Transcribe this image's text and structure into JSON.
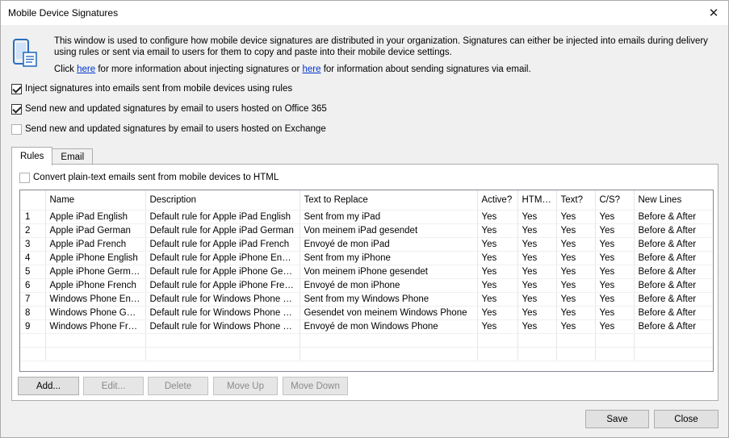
{
  "window": {
    "title": "Mobile Device Signatures"
  },
  "intro": {
    "paragraph": "This window is used to configure how mobile device signatures are distributed in your organization. Signatures can either be injected into emails during delivery using rules or sent via email to users for them to copy and paste into their mobile device settings.",
    "click": "Click ",
    "here1": "here",
    "middle": " for more information about injecting signatures or ",
    "here2": "here",
    "end": " for information about sending signatures via email."
  },
  "options": {
    "inject": {
      "label": "Inject signatures into emails sent from mobile devices using rules",
      "checked": true
    },
    "office365": {
      "label": "Send new and updated signatures by email to users hosted on Office 365",
      "checked": true
    },
    "exchange": {
      "label": "Send new and updated signatures by email to users hosted on Exchange",
      "checked": false
    }
  },
  "tabs": [
    "Rules",
    "Email"
  ],
  "convert": {
    "label": "Convert plain-text emails sent from mobile devices to HTML",
    "checked": false
  },
  "table": {
    "columns": [
      "",
      "Name",
      "Description",
      "Text to Replace",
      "Active?",
      "HTML?",
      "Text?",
      "C/S?",
      "New Lines"
    ],
    "rows": [
      [
        "1",
        "Apple iPad English",
        "Default rule for Apple iPad English",
        "Sent from my iPad",
        "Yes",
        "Yes",
        "Yes",
        "Yes",
        "Before & After"
      ],
      [
        "2",
        "Apple iPad German",
        "Default rule for Apple iPad German",
        "Von meinem iPad gesendet",
        "Yes",
        "Yes",
        "Yes",
        "Yes",
        "Before & After"
      ],
      [
        "3",
        "Apple iPad French",
        "Default rule for Apple iPad French",
        "Envoyé de mon iPad",
        "Yes",
        "Yes",
        "Yes",
        "Yes",
        "Before & After"
      ],
      [
        "4",
        "Apple iPhone English",
        "Default rule for Apple iPhone English",
        "Sent from my iPhone",
        "Yes",
        "Yes",
        "Yes",
        "Yes",
        "Before & After"
      ],
      [
        "5",
        "Apple iPhone German",
        "Default rule for Apple iPhone German",
        "Von meinem iPhone gesendet",
        "Yes",
        "Yes",
        "Yes",
        "Yes",
        "Before & After"
      ],
      [
        "6",
        "Apple iPhone French",
        "Default rule for Apple iPhone French",
        "Envoyé de mon iPhone",
        "Yes",
        "Yes",
        "Yes",
        "Yes",
        "Before & After"
      ],
      [
        "7",
        "Windows Phone English",
        "Default rule for Windows Phone English",
        "Sent from my Windows Phone",
        "Yes",
        "Yes",
        "Yes",
        "Yes",
        "Before & After"
      ],
      [
        "8",
        "Windows Phone German",
        "Default rule for Windows Phone German",
        "Gesendet von meinem Windows Phone",
        "Yes",
        "Yes",
        "Yes",
        "Yes",
        "Before & After"
      ],
      [
        "9",
        "Windows Phone French",
        "Default rule for Windows Phone French",
        "Envoyé de mon Windows Phone",
        "Yes",
        "Yes",
        "Yes",
        "Yes",
        "Before & After"
      ]
    ]
  },
  "buttons": {
    "add": "Add...",
    "edit": "Edit...",
    "delete": "Delete",
    "move_up": "Move Up",
    "move_down": "Move Down",
    "save": "Save",
    "close": "Close"
  },
  "colors": {
    "link": "#0033cc",
    "icon_blue": "#2a6ebd"
  }
}
